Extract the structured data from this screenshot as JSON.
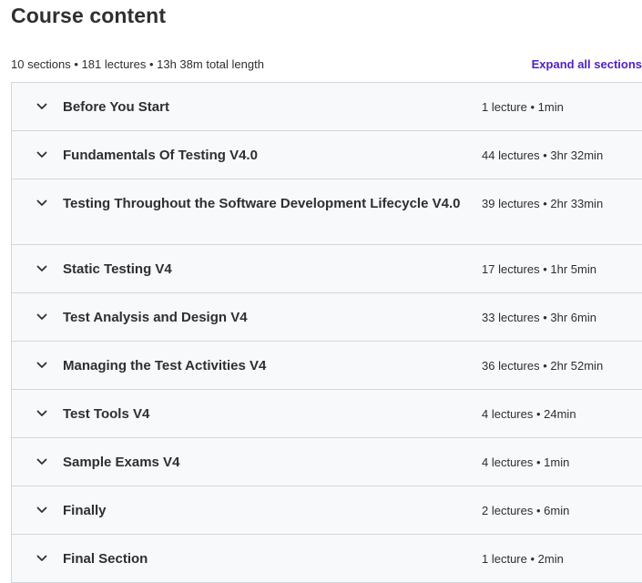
{
  "header": {
    "title": "Course content",
    "summary": "10 sections • 181 lectures • 13h 38m total length",
    "expand_all_label": "Expand all sections"
  },
  "sections": [
    {
      "title": "Before You Start",
      "meta": "1 lecture • 1min"
    },
    {
      "title": "Fundamentals Of Testing V4.0",
      "meta": "44 lectures • 3hr 32min"
    },
    {
      "title": "Testing Throughout the Software Development Lifecycle V4.0",
      "meta": "39 lectures • 2hr 33min"
    },
    {
      "title": "Static Testing V4",
      "meta": "17 lectures • 1hr 5min"
    },
    {
      "title": "Test Analysis and Design V4",
      "meta": "33 lectures • 3hr 6min"
    },
    {
      "title": "Managing the Test Activities V4",
      "meta": "36 lectures • 2hr 52min"
    },
    {
      "title": "Test Tools V4",
      "meta": "4 lectures • 24min"
    },
    {
      "title": "Sample Exams V4",
      "meta": "4 lectures • 1min"
    },
    {
      "title": "Finally",
      "meta": "2 lectures • 6min"
    },
    {
      "title": "Final Section",
      "meta": "1 lecture • 2min"
    }
  ],
  "colors": {
    "accent": "#5022c3",
    "section_bg": "#f7f9fa",
    "border": "#d1d7dc",
    "text": "#2d2f31"
  },
  "icons": {
    "section_toggle": "chevron-down-icon"
  }
}
